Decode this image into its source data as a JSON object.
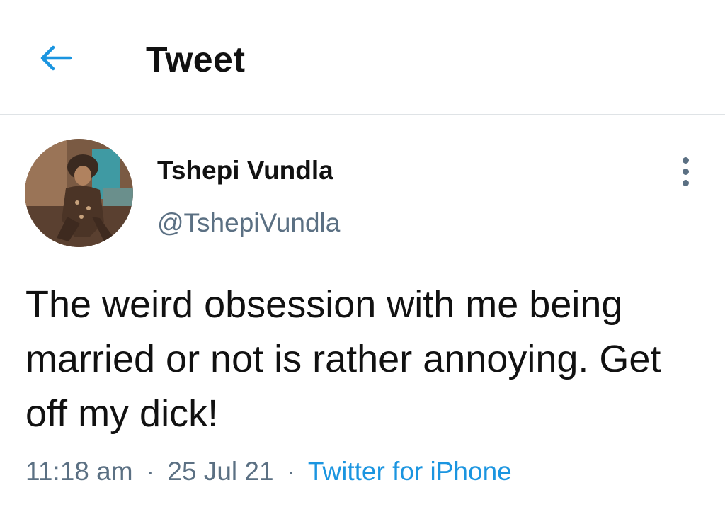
{
  "header": {
    "title": "Tweet",
    "back_icon": "arrow-left-icon",
    "accent_color": "#1b95e0"
  },
  "tweet": {
    "author_name": "Tshepi Vundla",
    "author_handle": "@TshepiVundla",
    "more_icon": "more-vertical-icon",
    "text": "The weird obsession with me being married or not is rather annoying. Get off my dick!",
    "time": "11:18 am",
    "separator": "·",
    "date": "25 Jul 21",
    "source": "Twitter for iPhone"
  }
}
